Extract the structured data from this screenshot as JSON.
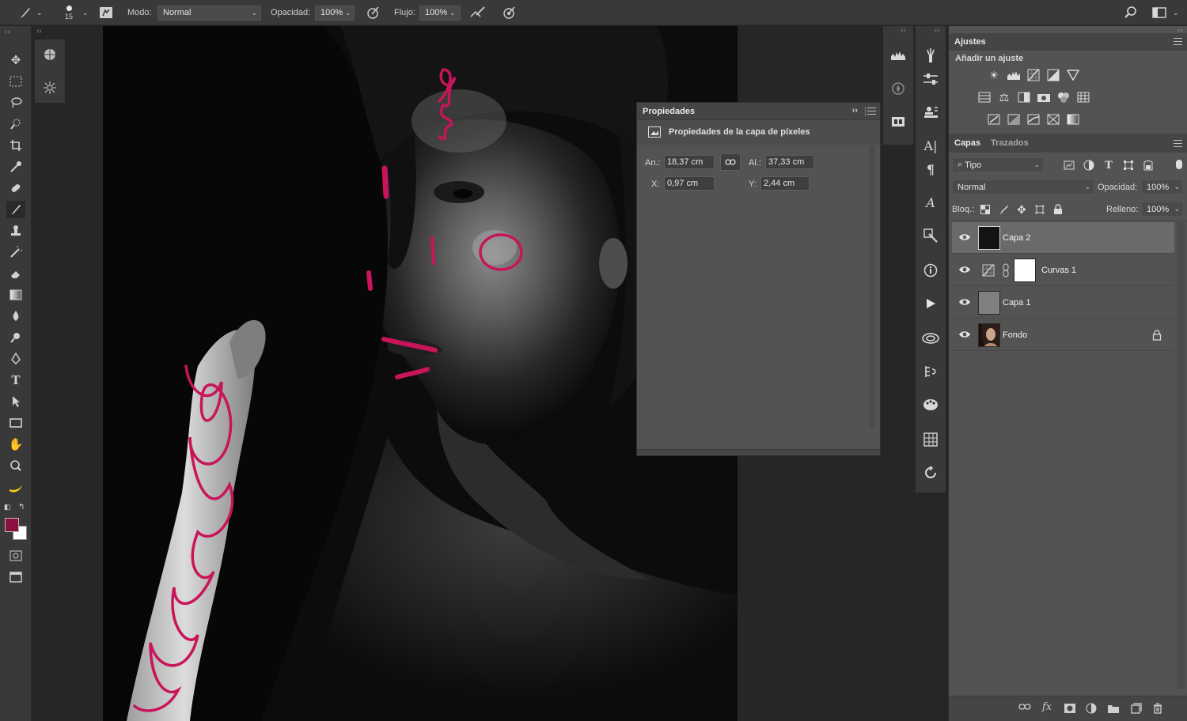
{
  "optionsbar": {
    "brush_size": "15",
    "mode_label": "Modo:",
    "mode_value": "Normal",
    "opacity_label": "Opacidad:",
    "opacity_value": "100%",
    "flow_label": "Flujo:",
    "flow_value": "100%"
  },
  "properties": {
    "title": "Propiedades",
    "subtitle": "Propiedades de la capa de píxeles",
    "width_label": "An.:",
    "width_value": "18,37 cm",
    "height_label": "Al.:",
    "height_value": "37,33 cm",
    "x_label": "X:",
    "x_value": "0,97 cm",
    "y_label": "Y:",
    "y_value": "2,44 cm"
  },
  "adjustments": {
    "tab": "Ajustes",
    "subtitle": "Añadir un ajuste"
  },
  "layers_panel": {
    "tab_layers": "Capas",
    "tab_paths": "Trazados",
    "filter_kind": "Tipo",
    "blend_mode": "Normal",
    "opacity_label": "Opacidad:",
    "opacity_value": "100%",
    "lock_label": "Bloq.:",
    "fill_label": "Relleno:",
    "fill_value": "100%",
    "layers": [
      {
        "name": "Capa 2",
        "active": true
      },
      {
        "name": "Curvas 1",
        "active": false
      },
      {
        "name": "Capa 1",
        "active": false
      },
      {
        "name": "Fondo",
        "active": false,
        "locked": true
      }
    ]
  },
  "colors": {
    "foreground": "#8a1040",
    "background": "#ffffff",
    "stroke": "#c8145a",
    "panel": "#535353",
    "chrome": "#393939"
  }
}
